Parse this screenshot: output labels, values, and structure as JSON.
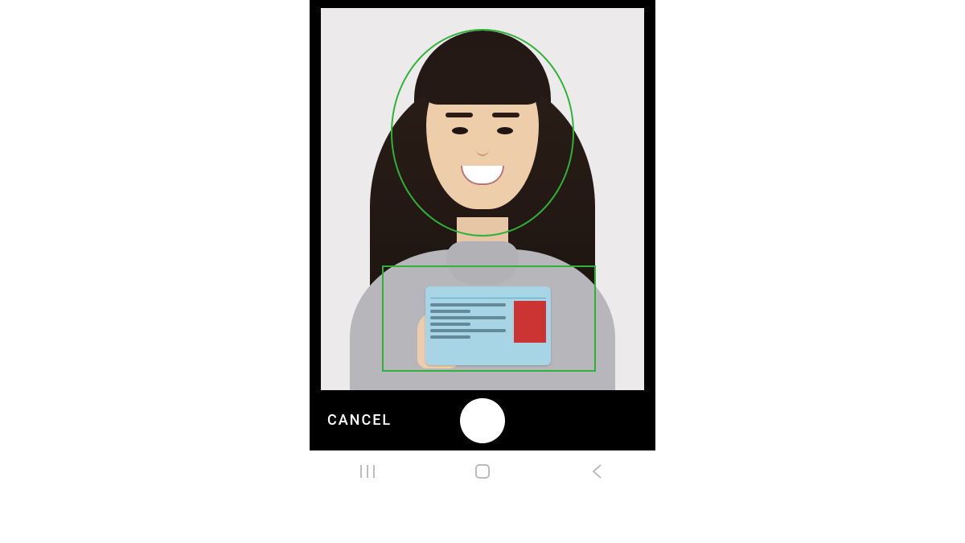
{
  "controls": {
    "cancel_label": "CANCEL",
    "shutter_name": "shutter-button",
    "overlay_color": "#2fb23a"
  },
  "nav": {
    "recent": "recent-apps-icon",
    "home": "home-icon",
    "back": "back-icon"
  }
}
